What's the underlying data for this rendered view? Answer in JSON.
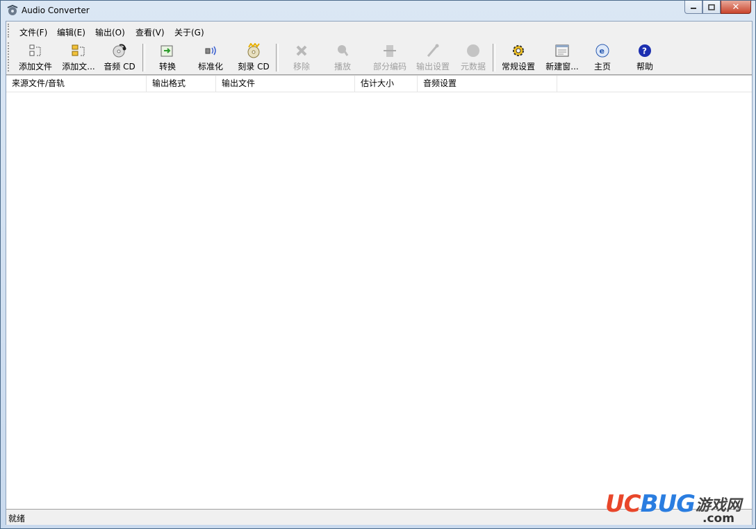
{
  "window": {
    "title": "Audio Converter"
  },
  "menu": [
    {
      "label": "文件(F)"
    },
    {
      "label": "编辑(E)"
    },
    {
      "label": "输出(O)"
    },
    {
      "label": "查看(V)"
    },
    {
      "label": "关于(G)"
    }
  ],
  "toolbar": [
    {
      "label": "添加文件",
      "icon": "add-file-icon",
      "enabled": true
    },
    {
      "label": "添加文...",
      "icon": "add-folder-icon",
      "enabled": true
    },
    {
      "label": "音频 CD",
      "icon": "audio-cd-icon",
      "enabled": true
    },
    {
      "label": "转换",
      "icon": "convert-icon",
      "enabled": true
    },
    {
      "label": "标准化",
      "icon": "normalize-icon",
      "enabled": true
    },
    {
      "label": "刻录 CD",
      "icon": "burn-cd-icon",
      "enabled": true
    },
    {
      "label": "移除",
      "icon": "remove-icon",
      "enabled": false
    },
    {
      "label": "播放",
      "icon": "play-icon",
      "enabled": false
    },
    {
      "label": "部分编码",
      "icon": "partial-encode-icon",
      "enabled": false
    },
    {
      "label": "输出设置",
      "icon": "output-settings-icon",
      "enabled": false
    },
    {
      "label": "元数据",
      "icon": "metadata-icon",
      "enabled": false
    },
    {
      "label": "常规设置",
      "icon": "general-settings-icon",
      "enabled": true
    },
    {
      "label": "新建窗...",
      "icon": "new-window-icon",
      "enabled": true
    },
    {
      "label": "主页",
      "icon": "homepage-icon",
      "enabled": true
    },
    {
      "label": "帮助",
      "icon": "help-icon",
      "enabled": true
    }
  ],
  "list": {
    "columns": [
      "来源文件/音轨",
      "输出格式",
      "输出文件",
      "估计大小",
      "音频设置"
    ],
    "rows": []
  },
  "status": {
    "text": "就绪"
  },
  "watermark": {
    "brand": "UCBUG",
    "cn": "游戏网",
    "domain": ".com",
    "brand_color": "#e8462a",
    "brand_color2": "#2a7de0"
  }
}
